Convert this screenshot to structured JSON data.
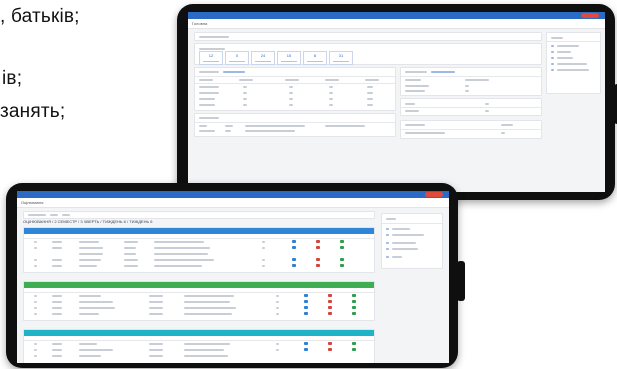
{
  "slide_text": {
    "line1": ", батьків;",
    "line2": "ів;",
    "line3": "занять;"
  },
  "tablet_top": {
    "app_title": "Головна",
    "stat_tiles": [
      "12",
      "0",
      "24",
      "15",
      "8",
      "31"
    ]
  },
  "tablet_bottom": {
    "app_title": "Оцінювання",
    "breadcrumb": "ОЦІНЮВАННЯ / 2 СЕМЕСТР / 3 ЧВЕРТЬ / ТИЖДЕНЬ 6 / ТИЖДЕНЬ 6",
    "colors": {
      "section1": "#2f86d6",
      "section2": "#3fae52",
      "section3": "#1fb3c8",
      "green_dot": "#2e9e4a",
      "blue_dot": "#2f7fd6",
      "red_dot": "#d9413b"
    }
  }
}
